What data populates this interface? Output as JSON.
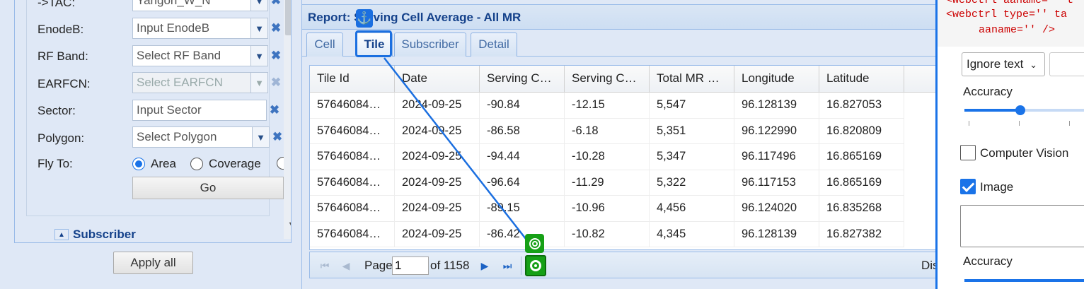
{
  "filters": {
    "tac": {
      "label": "->TAC:",
      "value": "Yangon_W_N"
    },
    "enodeb": {
      "label": "EnodeB:",
      "placeholder": "Input EnodeB"
    },
    "rf_band": {
      "label": "RF Band:",
      "placeholder": "Select RF Band"
    },
    "earfcn": {
      "label": "EARFCN:",
      "placeholder": "Select EARFCN"
    },
    "sector": {
      "label": "Sector:",
      "placeholder": "Input Sector"
    },
    "polygon": {
      "label": "Polygon:",
      "placeholder": "Select Polygon"
    },
    "fly_to": {
      "label": "Fly To:",
      "options": [
        "Area",
        "Coverage"
      ],
      "selected": "Area"
    },
    "go_label": "Go",
    "subscriber_section": "Subscriber",
    "apply_all_label": "Apply all"
  },
  "report": {
    "title": "Report: Serving Cell Average - All MR",
    "tabs": [
      "Cell",
      "Tile",
      "Subscriber",
      "Detail"
    ],
    "active_tab": "Tile",
    "columns": [
      "Tile Id",
      "Date",
      "Serving Cell…",
      "Serving Cell…",
      "Total MR C…",
      "Longitude",
      "Latitude",
      ""
    ],
    "rows": [
      [
        "576460848…",
        "2024-09-25",
        "-90.84",
        "-12.15",
        "5,547",
        "96.128139",
        "16.827053"
      ],
      [
        "576460848…",
        "2024-09-25",
        "-86.58",
        "-6.18",
        "5,351",
        "96.122990",
        "16.820809"
      ],
      [
        "576460848…",
        "2024-09-25",
        "-94.44",
        "-10.28",
        "5,347",
        "96.117496",
        "16.865169"
      ],
      [
        "576460848…",
        "2024-09-25",
        "-96.64",
        "-11.29",
        "5,322",
        "96.117153",
        "16.865169"
      ],
      [
        "576460848…",
        "2024-09-25",
        "-89.15",
        "-10.96",
        "4,456",
        "96.124020",
        "16.835268"
      ],
      [
        "576460848…",
        "2024-09-25",
        "-86.42",
        "-10.82",
        "4,345",
        "96.128139",
        "16.827382"
      ]
    ],
    "pager": {
      "page_label": "Page",
      "page_value": "1",
      "of_label": "of 1158",
      "display_text": "Dis"
    }
  },
  "properties": {
    "code_lines": [
      "<webctrl aaname='' t",
      "<webctrl type='' ta",
      "aaname='' />"
    ],
    "ignore_text": "Ignore text",
    "accuracy_label": "Accuracy",
    "accuracy_level_fraction": 0.45,
    "computer_vision": {
      "label": "Computer Vision",
      "checked": false
    },
    "image": {
      "label": "Image",
      "checked": true
    },
    "accuracy_label_2": "Accuracy"
  },
  "colors": {
    "accent": "#1a73e8",
    "header_text": "#15428b",
    "target_green": "#16a016"
  }
}
